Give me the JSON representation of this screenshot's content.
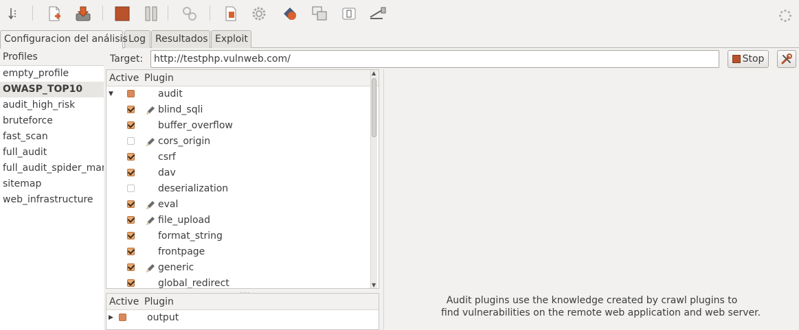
{
  "tabs": [
    {
      "label": "Configuracion del análisis",
      "active": true
    },
    {
      "label": "Log",
      "active": false
    },
    {
      "label": "Resultados",
      "active": false
    },
    {
      "label": "Exploit",
      "active": false
    }
  ],
  "profiles": {
    "header": "Profiles",
    "items": [
      {
        "label": "empty_profile",
        "selected": false
      },
      {
        "label": "OWASP_TOP10",
        "selected": true
      },
      {
        "label": "audit_high_risk",
        "selected": false
      },
      {
        "label": "bruteforce",
        "selected": false
      },
      {
        "label": "fast_scan",
        "selected": false
      },
      {
        "label": "full_audit",
        "selected": false
      },
      {
        "label": "full_audit_spider_man",
        "selected": false
      },
      {
        "label": "sitemap",
        "selected": false
      },
      {
        "label": "web_infrastructure",
        "selected": false
      }
    ]
  },
  "target": {
    "label": "Target:",
    "value": "http://testphp.vulnweb.com/",
    "stop_label": "Stop"
  },
  "plugin_tree": {
    "header_active": "Active",
    "header_plugin": "Plugin",
    "root": {
      "label": "audit",
      "expanded": true,
      "state": "partial"
    },
    "rows": [
      {
        "label": "blind_sqli",
        "checked": true,
        "editable": true
      },
      {
        "label": "buffer_overflow",
        "checked": true,
        "editable": false
      },
      {
        "label": "cors_origin",
        "checked": false,
        "editable": true
      },
      {
        "label": "csrf",
        "checked": true,
        "editable": false
      },
      {
        "label": "dav",
        "checked": true,
        "editable": false
      },
      {
        "label": "deserialization",
        "checked": false,
        "editable": false
      },
      {
        "label": "eval",
        "checked": true,
        "editable": true
      },
      {
        "label": "file_upload",
        "checked": true,
        "editable": true
      },
      {
        "label": "format_string",
        "checked": true,
        "editable": false
      },
      {
        "label": "frontpage",
        "checked": true,
        "editable": false
      },
      {
        "label": "generic",
        "checked": true,
        "editable": true
      },
      {
        "label": "global_redirect",
        "checked": true,
        "editable": false
      }
    ]
  },
  "output_tree": {
    "header_active": "Active",
    "header_plugin": "Plugin",
    "root": {
      "label": "output",
      "expanded": false,
      "state": "partial"
    }
  },
  "description": {
    "line1": "Audit plugins use the knowledge created by crawl plugins to",
    "line2": "find vulnerabilities on the remote web application and web server."
  },
  "toolbar_icons": [
    "arrow-down-icon",
    "new-profile-icon",
    "save-profile-icon",
    "stop-icon",
    "pause-icon",
    "scan-gear-icon",
    "open-icon",
    "settings-gear-icon",
    "exploit-icon",
    "windows-icon",
    "counter-icon",
    "proxy-icon"
  ],
  "colors": {
    "accent": "#e9a86e",
    "stop": "#b9522a",
    "panel": "#f2f1f0"
  }
}
